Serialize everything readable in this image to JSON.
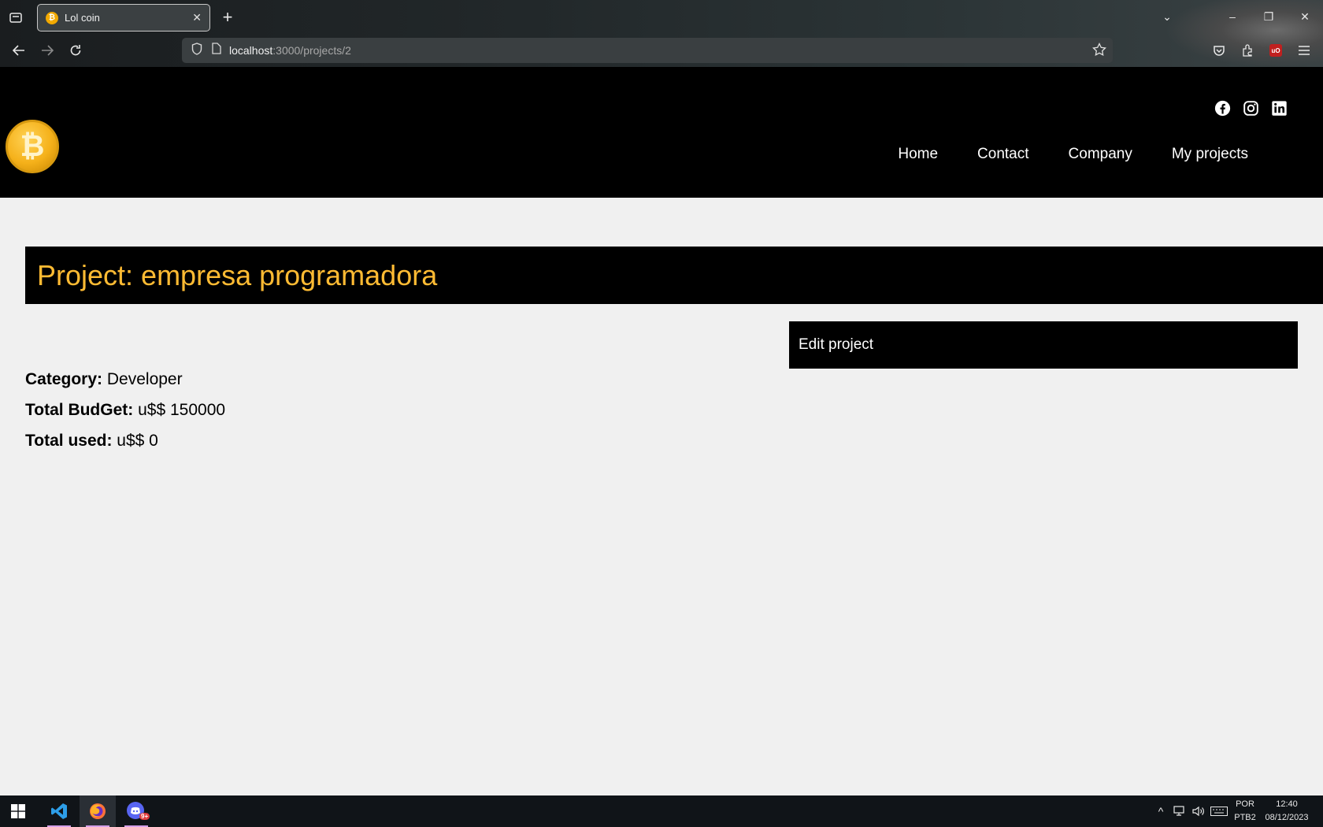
{
  "browser": {
    "tab_title": "Lol coin",
    "url_host": "localhost",
    "url_path": ":3000/projects/2",
    "favicon_glyph": "₿"
  },
  "site": {
    "logo_glyph": "₿",
    "nav": [
      "Home",
      "Contact",
      "Company",
      "My projects"
    ],
    "socials": [
      "facebook-icon",
      "instagram-icon",
      "linkedin-icon"
    ]
  },
  "project": {
    "title": "Project: empresa programadora",
    "edit_label": "Edit project",
    "category_label": "Category:",
    "category_value": "Developer",
    "budget_label": "Total BudGet:",
    "budget_value": "u$$ 150000",
    "used_label": "Total used:",
    "used_value": "u$$ 0"
  },
  "taskbar": {
    "lang": "POR",
    "layout": "PTB2",
    "time": "12:40",
    "date": "08/12/2023",
    "discord_badge": "9+"
  },
  "colors": {
    "title_accent": "#ffbb33",
    "header_bg": "#000000",
    "page_bg": "#f0f0f0"
  }
}
